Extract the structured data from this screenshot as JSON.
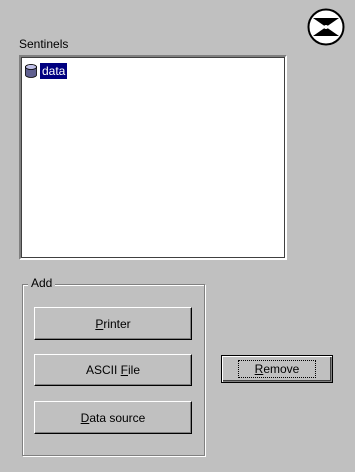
{
  "sentinels": {
    "label": "Sentinels",
    "items": [
      {
        "label": "data"
      }
    ]
  },
  "add_group": {
    "label": "Add",
    "printer_button": {
      "mnemonic": "P",
      "rest": "rinter"
    },
    "ascii_button": {
      "pre": "ASCII ",
      "mnemonic": "F",
      "rest": "ile"
    },
    "datasource_button": {
      "mnemonic": "D",
      "rest": "ata source"
    }
  },
  "remove_button": {
    "mnemonic": "R",
    "rest": "emove"
  },
  "icons": {
    "database": "database-icon",
    "logo": "hourglass-logo-icon"
  }
}
